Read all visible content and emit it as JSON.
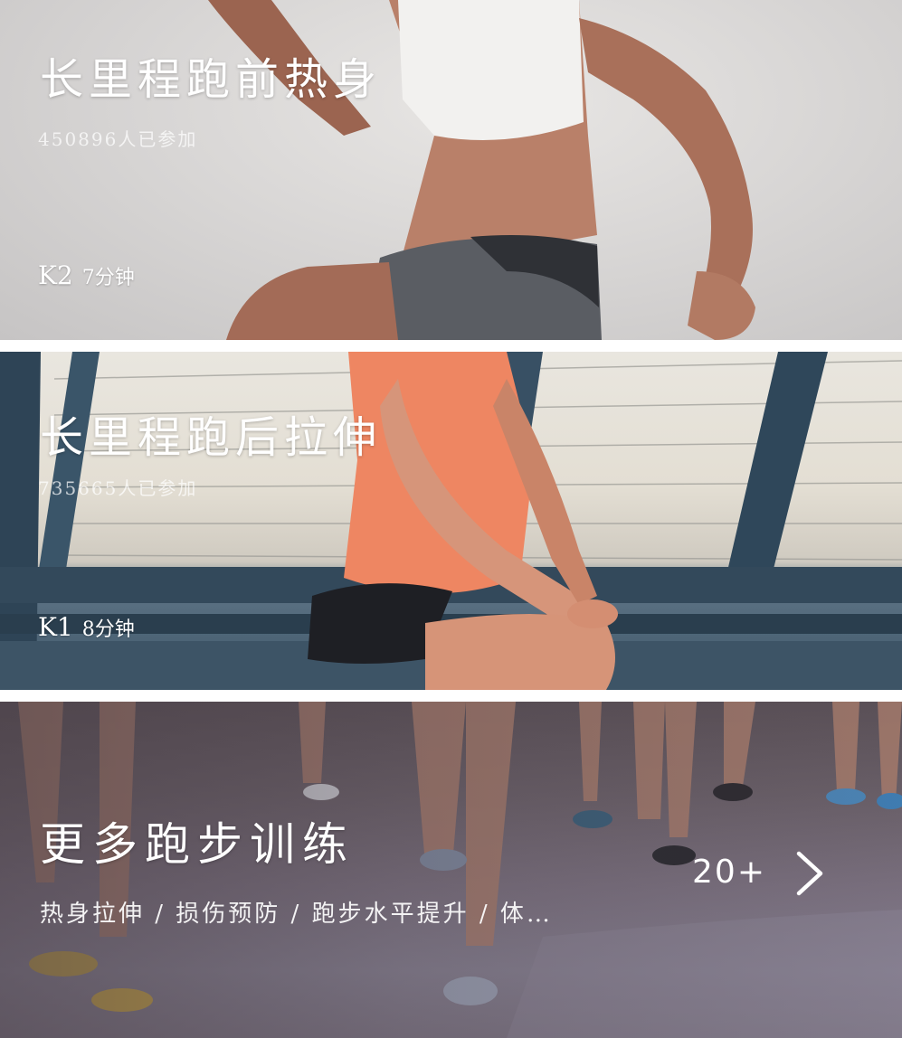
{
  "cards": [
    {
      "title": "长里程跑前热身",
      "participants": "450896人已参加",
      "level": "K2",
      "duration": "7分钟"
    },
    {
      "title": "长里程跑后拉伸",
      "participants": "735665人已参加",
      "level": "K1",
      "duration": "8分钟"
    }
  ],
  "more": {
    "title": "更多跑步训练",
    "tags": "热身拉伸 / 损伤预防 / 跑步水平提升 / 体…",
    "count": "20+",
    "arrow_icon": "chevron-right-icon"
  }
}
